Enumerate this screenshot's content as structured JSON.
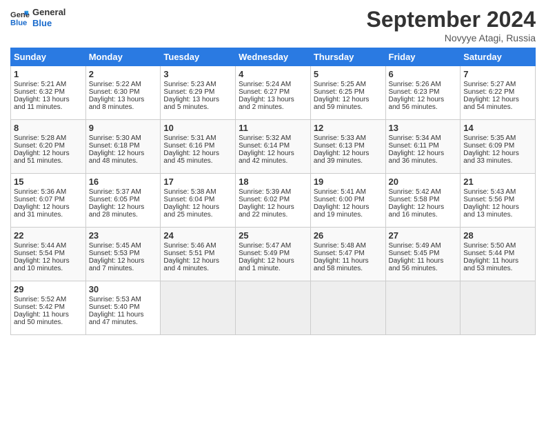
{
  "header": {
    "logo_line1": "General",
    "logo_line2": "Blue",
    "month": "September 2024",
    "location": "Novyye Atagi, Russia"
  },
  "weekdays": [
    "Sunday",
    "Monday",
    "Tuesday",
    "Wednesday",
    "Thursday",
    "Friday",
    "Saturday"
  ],
  "weeks": [
    [
      {
        "day": "1",
        "lines": [
          "Sunrise: 5:21 AM",
          "Sunset: 6:32 PM",
          "Daylight: 13 hours",
          "and 11 minutes."
        ]
      },
      {
        "day": "2",
        "lines": [
          "Sunrise: 5:22 AM",
          "Sunset: 6:30 PM",
          "Daylight: 13 hours",
          "and 8 minutes."
        ]
      },
      {
        "day": "3",
        "lines": [
          "Sunrise: 5:23 AM",
          "Sunset: 6:29 PM",
          "Daylight: 13 hours",
          "and 5 minutes."
        ]
      },
      {
        "day": "4",
        "lines": [
          "Sunrise: 5:24 AM",
          "Sunset: 6:27 PM",
          "Daylight: 13 hours",
          "and 2 minutes."
        ]
      },
      {
        "day": "5",
        "lines": [
          "Sunrise: 5:25 AM",
          "Sunset: 6:25 PM",
          "Daylight: 12 hours",
          "and 59 minutes."
        ]
      },
      {
        "day": "6",
        "lines": [
          "Sunrise: 5:26 AM",
          "Sunset: 6:23 PM",
          "Daylight: 12 hours",
          "and 56 minutes."
        ]
      },
      {
        "day": "7",
        "lines": [
          "Sunrise: 5:27 AM",
          "Sunset: 6:22 PM",
          "Daylight: 12 hours",
          "and 54 minutes."
        ]
      }
    ],
    [
      {
        "day": "8",
        "lines": [
          "Sunrise: 5:28 AM",
          "Sunset: 6:20 PM",
          "Daylight: 12 hours",
          "and 51 minutes."
        ]
      },
      {
        "day": "9",
        "lines": [
          "Sunrise: 5:30 AM",
          "Sunset: 6:18 PM",
          "Daylight: 12 hours",
          "and 48 minutes."
        ]
      },
      {
        "day": "10",
        "lines": [
          "Sunrise: 5:31 AM",
          "Sunset: 6:16 PM",
          "Daylight: 12 hours",
          "and 45 minutes."
        ]
      },
      {
        "day": "11",
        "lines": [
          "Sunrise: 5:32 AM",
          "Sunset: 6:14 PM",
          "Daylight: 12 hours",
          "and 42 minutes."
        ]
      },
      {
        "day": "12",
        "lines": [
          "Sunrise: 5:33 AM",
          "Sunset: 6:13 PM",
          "Daylight: 12 hours",
          "and 39 minutes."
        ]
      },
      {
        "day": "13",
        "lines": [
          "Sunrise: 5:34 AM",
          "Sunset: 6:11 PM",
          "Daylight: 12 hours",
          "and 36 minutes."
        ]
      },
      {
        "day": "14",
        "lines": [
          "Sunrise: 5:35 AM",
          "Sunset: 6:09 PM",
          "Daylight: 12 hours",
          "and 33 minutes."
        ]
      }
    ],
    [
      {
        "day": "15",
        "lines": [
          "Sunrise: 5:36 AM",
          "Sunset: 6:07 PM",
          "Daylight: 12 hours",
          "and 31 minutes."
        ]
      },
      {
        "day": "16",
        "lines": [
          "Sunrise: 5:37 AM",
          "Sunset: 6:05 PM",
          "Daylight: 12 hours",
          "and 28 minutes."
        ]
      },
      {
        "day": "17",
        "lines": [
          "Sunrise: 5:38 AM",
          "Sunset: 6:04 PM",
          "Daylight: 12 hours",
          "and 25 minutes."
        ]
      },
      {
        "day": "18",
        "lines": [
          "Sunrise: 5:39 AM",
          "Sunset: 6:02 PM",
          "Daylight: 12 hours",
          "and 22 minutes."
        ]
      },
      {
        "day": "19",
        "lines": [
          "Sunrise: 5:41 AM",
          "Sunset: 6:00 PM",
          "Daylight: 12 hours",
          "and 19 minutes."
        ]
      },
      {
        "day": "20",
        "lines": [
          "Sunrise: 5:42 AM",
          "Sunset: 5:58 PM",
          "Daylight: 12 hours",
          "and 16 minutes."
        ]
      },
      {
        "day": "21",
        "lines": [
          "Sunrise: 5:43 AM",
          "Sunset: 5:56 PM",
          "Daylight: 12 hours",
          "and 13 minutes."
        ]
      }
    ],
    [
      {
        "day": "22",
        "lines": [
          "Sunrise: 5:44 AM",
          "Sunset: 5:54 PM",
          "Daylight: 12 hours",
          "and 10 minutes."
        ]
      },
      {
        "day": "23",
        "lines": [
          "Sunrise: 5:45 AM",
          "Sunset: 5:53 PM",
          "Daylight: 12 hours",
          "and 7 minutes."
        ]
      },
      {
        "day": "24",
        "lines": [
          "Sunrise: 5:46 AM",
          "Sunset: 5:51 PM",
          "Daylight: 12 hours",
          "and 4 minutes."
        ]
      },
      {
        "day": "25",
        "lines": [
          "Sunrise: 5:47 AM",
          "Sunset: 5:49 PM",
          "Daylight: 12 hours",
          "and 1 minute."
        ]
      },
      {
        "day": "26",
        "lines": [
          "Sunrise: 5:48 AM",
          "Sunset: 5:47 PM",
          "Daylight: 11 hours",
          "and 58 minutes."
        ]
      },
      {
        "day": "27",
        "lines": [
          "Sunrise: 5:49 AM",
          "Sunset: 5:45 PM",
          "Daylight: 11 hours",
          "and 56 minutes."
        ]
      },
      {
        "day": "28",
        "lines": [
          "Sunrise: 5:50 AM",
          "Sunset: 5:44 PM",
          "Daylight: 11 hours",
          "and 53 minutes."
        ]
      }
    ],
    [
      {
        "day": "29",
        "lines": [
          "Sunrise: 5:52 AM",
          "Sunset: 5:42 PM",
          "Daylight: 11 hours",
          "and 50 minutes."
        ]
      },
      {
        "day": "30",
        "lines": [
          "Sunrise: 5:53 AM",
          "Sunset: 5:40 PM",
          "Daylight: 11 hours",
          "and 47 minutes."
        ]
      },
      {
        "day": "",
        "lines": []
      },
      {
        "day": "",
        "lines": []
      },
      {
        "day": "",
        "lines": []
      },
      {
        "day": "",
        "lines": []
      },
      {
        "day": "",
        "lines": []
      }
    ]
  ]
}
